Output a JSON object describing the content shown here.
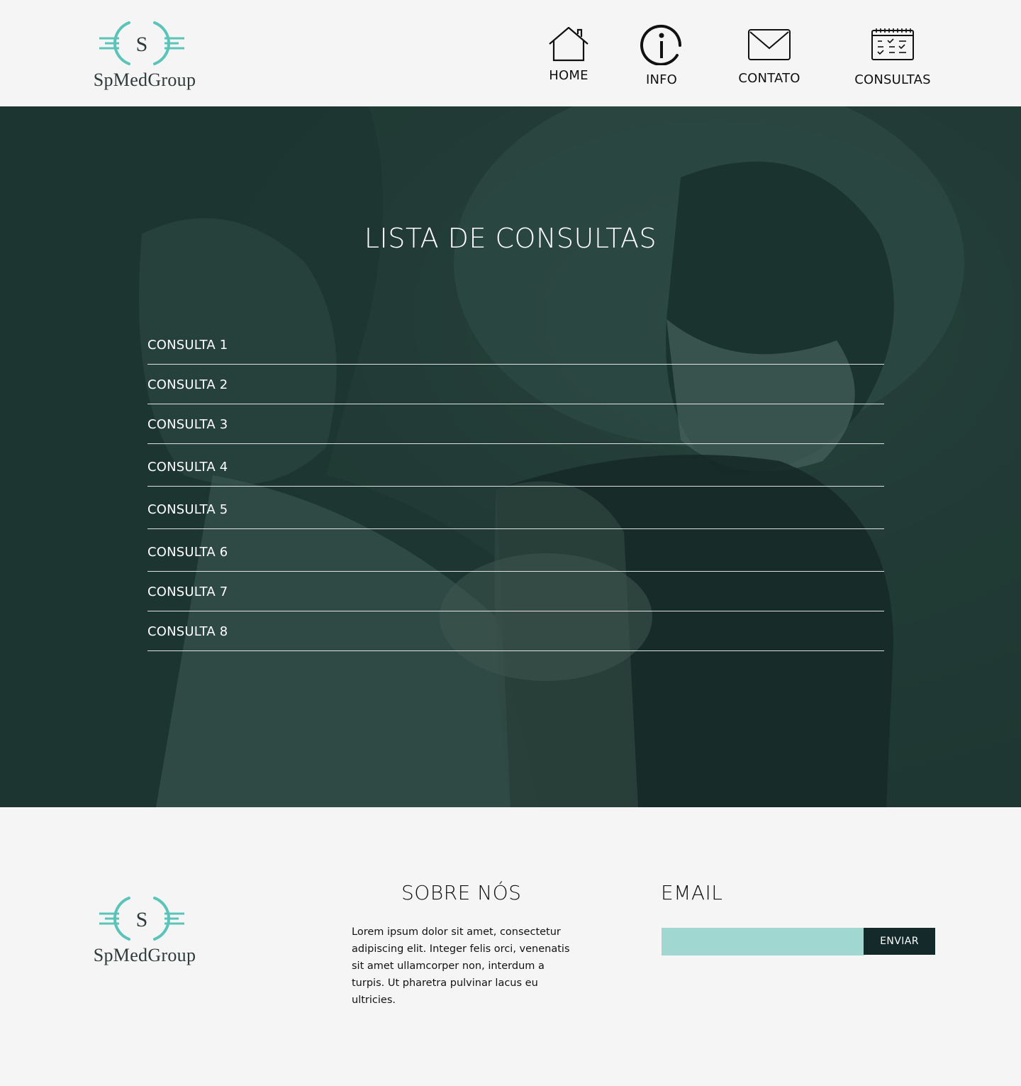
{
  "header": {
    "logo_text": "SpMedGroup",
    "logo_letter": "S",
    "nav": [
      {
        "label": "HOME",
        "icon": "house-icon"
      },
      {
        "label": "INFO",
        "icon": "info-icon"
      },
      {
        "label": "CONTATO",
        "icon": "envelope-icon"
      },
      {
        "label": "CONSULTAS",
        "icon": "calendar-icon"
      }
    ]
  },
  "hero": {
    "title": "LISTA DE CONSULTAS",
    "items": [
      {
        "label": "CONSULTA 1"
      },
      {
        "label": "CONSULTA 2"
      },
      {
        "label": "CONSULTA 3"
      },
      {
        "label": "CONSULTA 4"
      },
      {
        "label": "CONSULTA 5"
      },
      {
        "label": "CONSULTA 6"
      },
      {
        "label": "CONSULTA 7"
      },
      {
        "label": "CONSULTA 8"
      }
    ]
  },
  "footer": {
    "logo_text": "SpMedGroup",
    "logo_letter": "S",
    "about_title": "SOBRE NÓS",
    "about_text": "Lorem ipsum dolor sit amet, consectetur adipiscing elit. Integer felis orci, venenatis sit amet ullamcorper non, interdum a turpis. Ut pharetra pulvinar lacus eu ultricies.",
    "email_title": "EMAIL",
    "email_value": "",
    "email_button": "ENVIAR"
  },
  "colors": {
    "accent": "#5bc4b9",
    "input_bg": "#a0d7d1",
    "button_bg": "#13292a",
    "page_bg": "#f5f5f5"
  }
}
